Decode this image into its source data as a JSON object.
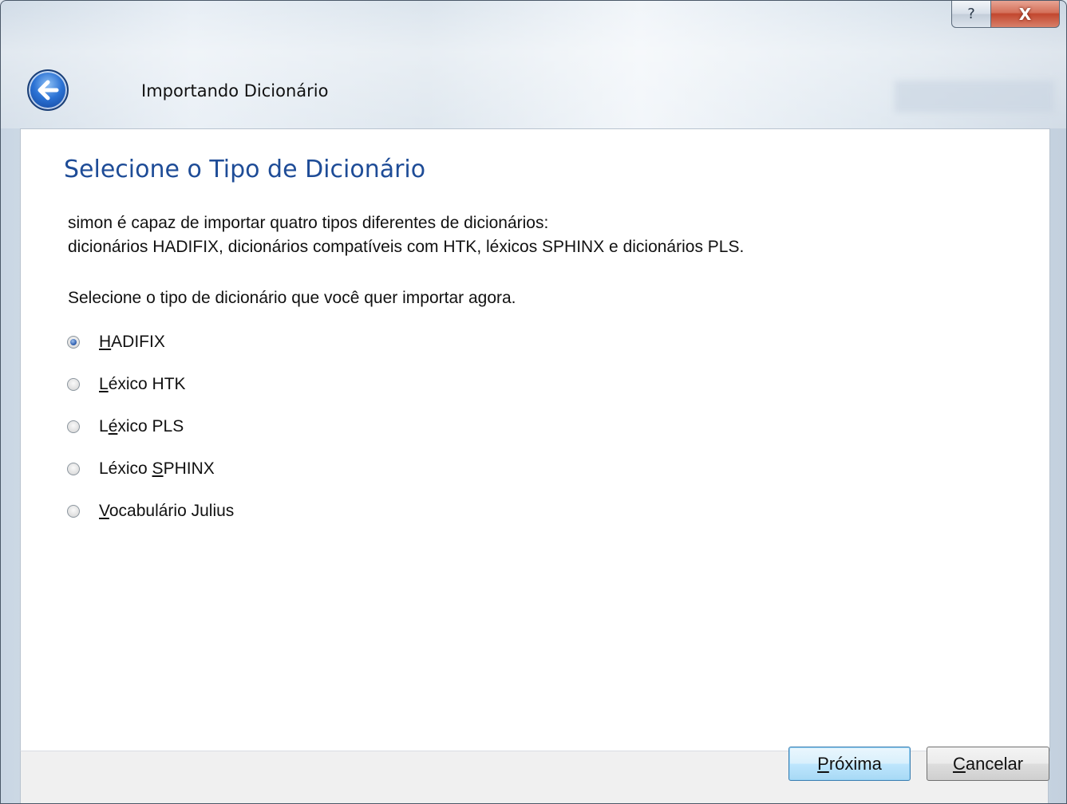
{
  "window": {
    "help_glyph": "?",
    "close_glyph": "X"
  },
  "header": {
    "title": "Importando Dicionário"
  },
  "page": {
    "heading": "Selecione o Tipo de Dicionário",
    "description_line1": "simon é capaz de importar quatro tipos diferentes de dicionários:",
    "description_line2": "dicionários HADIFIX, dicionários compatíveis com HTK, léxicos SPHINX e dicionários PLS.",
    "prompt": "Selecione o tipo de dicionário que você quer importar agora."
  },
  "options": [
    {
      "label_pre": "",
      "label_accel": "H",
      "label_post": "ADIFIX",
      "selected": true
    },
    {
      "label_pre": "",
      "label_accel": "L",
      "label_post": "éxico HTK",
      "selected": false
    },
    {
      "label_pre": "L",
      "label_accel": "é",
      "label_post": "xico PLS",
      "selected": false
    },
    {
      "label_pre": "Léxico ",
      "label_accel": "S",
      "label_post": "PHINX",
      "selected": false
    },
    {
      "label_pre": "",
      "label_accel": "V",
      "label_post": "ocabulário Julius",
      "selected": false
    }
  ],
  "footer": {
    "next_accel": "P",
    "next_rest": "róxima",
    "cancel_accel": "C",
    "cancel_rest": "ancelar"
  },
  "colors": {
    "heading": "#1e4c97",
    "back_button": "#2b72d4",
    "close_button": "#c2472e"
  }
}
